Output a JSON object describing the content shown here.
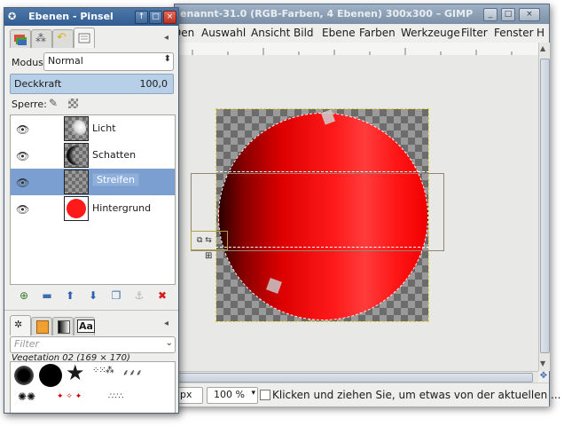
{
  "colors": {
    "title_active": "#2f5c92",
    "title_inactive": "#8a9db2",
    "selection": "#7a9fd0",
    "sphere": "#ff1a1a"
  },
  "main_window": {
    "title": "enannt-31.0 (RGB-Farben, 4 Ebenen) 300x300 – GIMP",
    "window_buttons": [
      "_",
      "□",
      "×"
    ],
    "menu": [
      "Den",
      "Auswahl",
      "Ansicht",
      "Bild",
      "Ebene",
      "Farben",
      "Werkzeuge",
      "Filter",
      "Fenster",
      "H"
    ],
    "status": {
      "unit": "px",
      "zoom": "100 %",
      "message": "Klicken und ziehen Sie, um etwas von der aktuellen ..."
    },
    "icons": [
      "navigate-icon",
      "quick-mask-icon"
    ]
  },
  "dock": {
    "title": "Ebenen - Pinsel",
    "window_buttons": [
      "↑",
      "□",
      "×"
    ],
    "mode_label": "Modus:",
    "mode_value": "Normal",
    "opacity_label": "Deckkraft",
    "opacity_value": "100,0",
    "lock_label": "Sperre:",
    "layers": [
      {
        "name": "Licht",
        "visible": true,
        "selected": false
      },
      {
        "name": "Schatten",
        "visible": true,
        "selected": false
      },
      {
        "name": "Streifen",
        "visible": true,
        "selected": true
      },
      {
        "name": "Hintergrund",
        "visible": true,
        "selected": false
      }
    ],
    "layer_buttons": [
      "new-layer",
      "new-group",
      "raise-layer",
      "lower-layer",
      "duplicate-layer",
      "anchor-layer",
      "delete-layer"
    ],
    "filter_placeholder": "Filter",
    "brush_name": "Vegetation 02 (169 × 170)",
    "bottom_tabs": [
      "brushes",
      "patterns",
      "gradients",
      "fonts"
    ],
    "font_tab_glyph": "Aa"
  }
}
